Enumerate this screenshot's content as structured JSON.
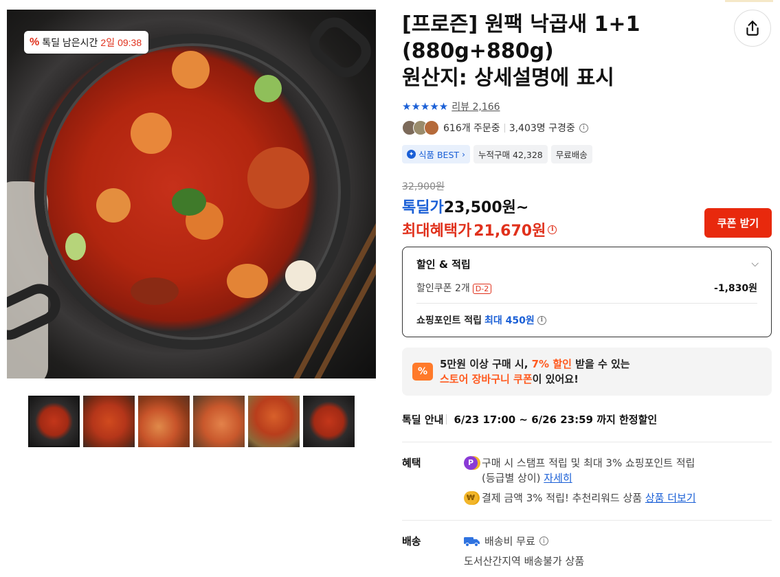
{
  "timer_badge": {
    "prefix": "톡딜 남은시간",
    "days": "2일",
    "time": "09:38"
  },
  "product": {
    "title": "[프로즌] 원팩 낙곱새 1+1 (880g+880g) 원산지: 상세설명에 표시",
    "title_line1": "[프로즌] 원팩 낙곱새 1+1",
    "title_line2": "(880g+880g)",
    "title_line3": "원산지: 상세설명에 표시",
    "rating_stars": "★★★★★",
    "review_label": "리뷰 2,166",
    "ordering_text": "616개 주문중",
    "viewing_text": "3,403명 구경중",
    "tags": {
      "best": "식품 BEST",
      "cumulative": "누적구매 42,328",
      "shipping": "무료배송"
    }
  },
  "pricing": {
    "original_price": "32,900원",
    "deal_label": "톡딜가",
    "deal_price": "23,500원~",
    "max_benefit_label": "최대혜택가",
    "max_benefit_price": "21,670원",
    "coupon_button": "쿠폰 받기"
  },
  "discount_box": {
    "title": "할인 & 적립",
    "coupon_label": "할인쿠폰 2개",
    "coupon_badge": "D-2",
    "coupon_amount": "-1,830원",
    "point_label": "쇼핑포인트 적립",
    "point_value": "최대 450원"
  },
  "cart_banner": {
    "line1_a": "5만원 이상 구매 시, ",
    "line1_b": "7% 할인",
    "line1_c": " 받을 수 있는",
    "line2_a": "스토어 장바구니 쿠폰",
    "line2_b": "이 있어요!",
    "icon": "%"
  },
  "deal_info": {
    "label": "톡딜 안내",
    "period": "6/23 17:00 ~ 6/26 23:59 까지 한정할인"
  },
  "benefits": {
    "label": "혜택",
    "line1": "구매 시 스탬프 적립 및 최대 3% 쇼핑포인트 적립",
    "line1b": "(등급별 상이)",
    "line1_link": "자세히",
    "line2": "결제 금액 3% 적립! 추천리워드 상품",
    "line2_link": "상품 더보기"
  },
  "shipping": {
    "label": "배송",
    "fee": "배송비 무료",
    "note": "도서산간지역 배송불가 상품"
  },
  "icons": {
    "share": "share-icon",
    "chevron": "chevron-down-icon",
    "info": "info-icon",
    "truck": "truck-icon"
  },
  "colors": {
    "accent_red": "#e0311c",
    "accent_blue": "#1a5fd6",
    "accent_orange": "#ff5a1f"
  }
}
